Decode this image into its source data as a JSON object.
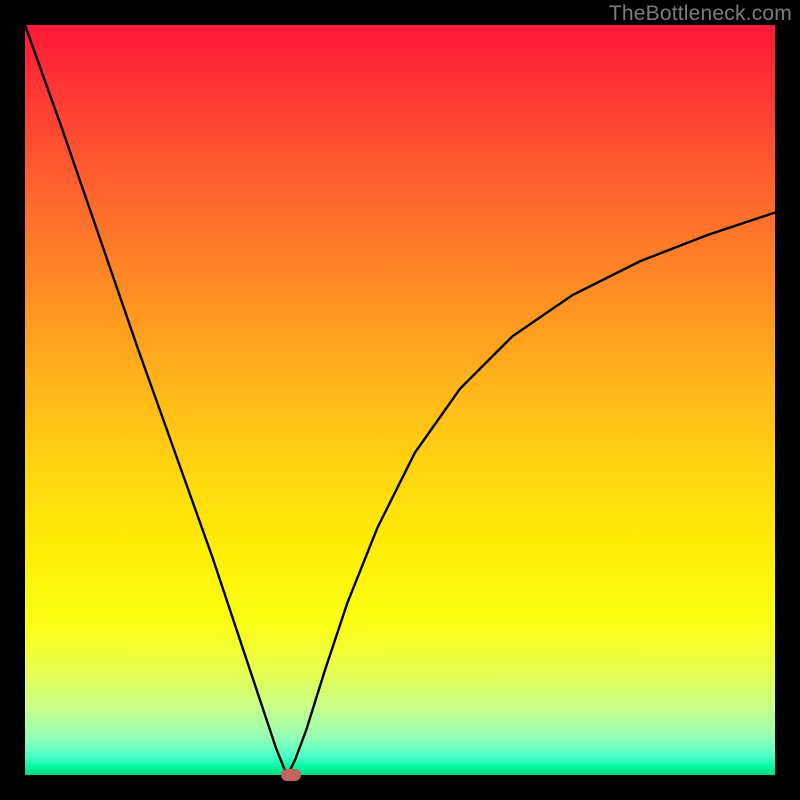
{
  "watermark": "TheBottleneck.com",
  "colors": {
    "frame": "#000000",
    "marker": "#c1645b",
    "curve": "#000000",
    "gradient_top": "#ff1837",
    "gradient_bottom": "#00da7e"
  },
  "chart_data": {
    "type": "line",
    "title": "",
    "xlabel": "",
    "ylabel": "",
    "xlim": [
      0,
      100
    ],
    "ylim": [
      0,
      100
    ],
    "grid": false,
    "notes": "Bottleneck curve: minimum (0) at x≈35; curve rises steeply on both sides. Left branch reaches y=100 at x=0; right branch asymptotically approaches y≈75 at x=100.",
    "series": [
      {
        "name": "left-branch",
        "x": [
          0,
          5,
          10,
          15,
          20,
          25,
          28,
          30,
          32,
          33.5,
          34.5,
          35
        ],
        "values": [
          100,
          86,
          71.5,
          57,
          43,
          29,
          20,
          14,
          8,
          3.5,
          1,
          0
        ]
      },
      {
        "name": "right-branch",
        "x": [
          35,
          36,
          37.5,
          40,
          43,
          47,
          52,
          58,
          65,
          73,
          82,
          91,
          100
        ],
        "values": [
          0,
          2,
          6,
          14,
          23,
          33,
          43,
          51.5,
          58.5,
          64,
          68.5,
          72,
          75
        ]
      }
    ],
    "marker": {
      "x": 35.5,
      "y": 0
    }
  }
}
